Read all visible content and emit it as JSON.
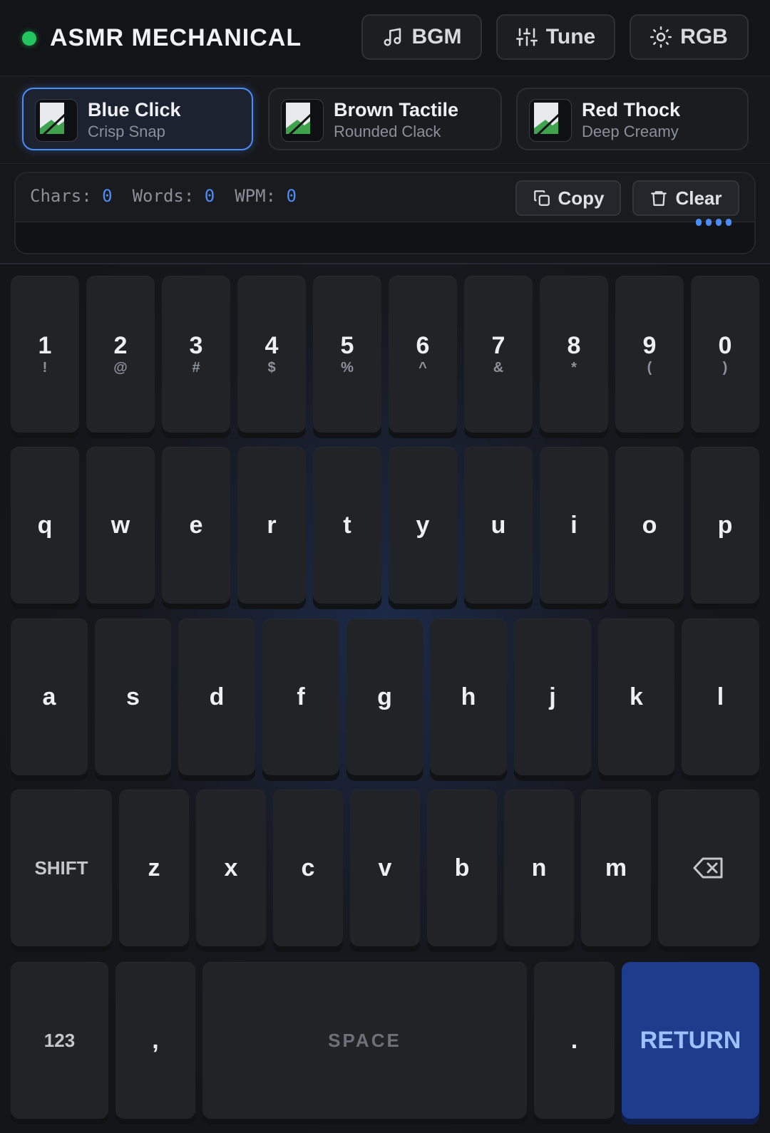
{
  "header": {
    "title": "ASMR MECHANICAL",
    "status_color": "#22c55e",
    "buttons": [
      {
        "label": "BGM",
        "icon": "music-note-icon"
      },
      {
        "label": "Tune",
        "icon": "sliders-icon"
      },
      {
        "label": "RGB",
        "icon": "sun-icon"
      }
    ]
  },
  "switches": [
    {
      "name": "Blue Click",
      "subtitle": "Crisp Snap",
      "active": true,
      "img_alt": "Bl"
    },
    {
      "name": "Brown Tactile",
      "subtitle": "Rounded Clack",
      "active": false,
      "img_alt": "Br"
    },
    {
      "name": "Red Thock",
      "subtitle": "Deep Creamy",
      "active": false,
      "img_alt": "Re"
    }
  ],
  "editor": {
    "stats": {
      "chars_label": "Chars:",
      "chars_value": "0",
      "words_label": "Words:",
      "words_value": "0",
      "wpm_label": "WPM:",
      "wpm_value": "0"
    },
    "copy_label": "Copy",
    "clear_label": "Clear",
    "text": ""
  },
  "keyboard": {
    "row_numbers": [
      {
        "main": "1",
        "sub": "!"
      },
      {
        "main": "2",
        "sub": "@"
      },
      {
        "main": "3",
        "sub": "#"
      },
      {
        "main": "4",
        "sub": "$"
      },
      {
        "main": "5",
        "sub": "%"
      },
      {
        "main": "6",
        "sub": "^"
      },
      {
        "main": "7",
        "sub": "&"
      },
      {
        "main": "8",
        "sub": "*"
      },
      {
        "main": "9",
        "sub": "("
      },
      {
        "main": "0",
        "sub": ")"
      }
    ],
    "row_top": [
      "q",
      "w",
      "e",
      "r",
      "t",
      "y",
      "u",
      "i",
      "o",
      "p"
    ],
    "row_home": [
      "a",
      "s",
      "d",
      "f",
      "g",
      "h",
      "j",
      "k",
      "l"
    ],
    "row_bottom": [
      "z",
      "x",
      "c",
      "v",
      "b",
      "n",
      "m"
    ],
    "shift_label": "SHIFT",
    "backspace_icon": "backspace-icon",
    "numbers_label": "123",
    "comma_label": ",",
    "space_label": "SPACE",
    "period_label": ".",
    "return_label": "RETURN",
    "accent_color": "#1e3b8c"
  }
}
